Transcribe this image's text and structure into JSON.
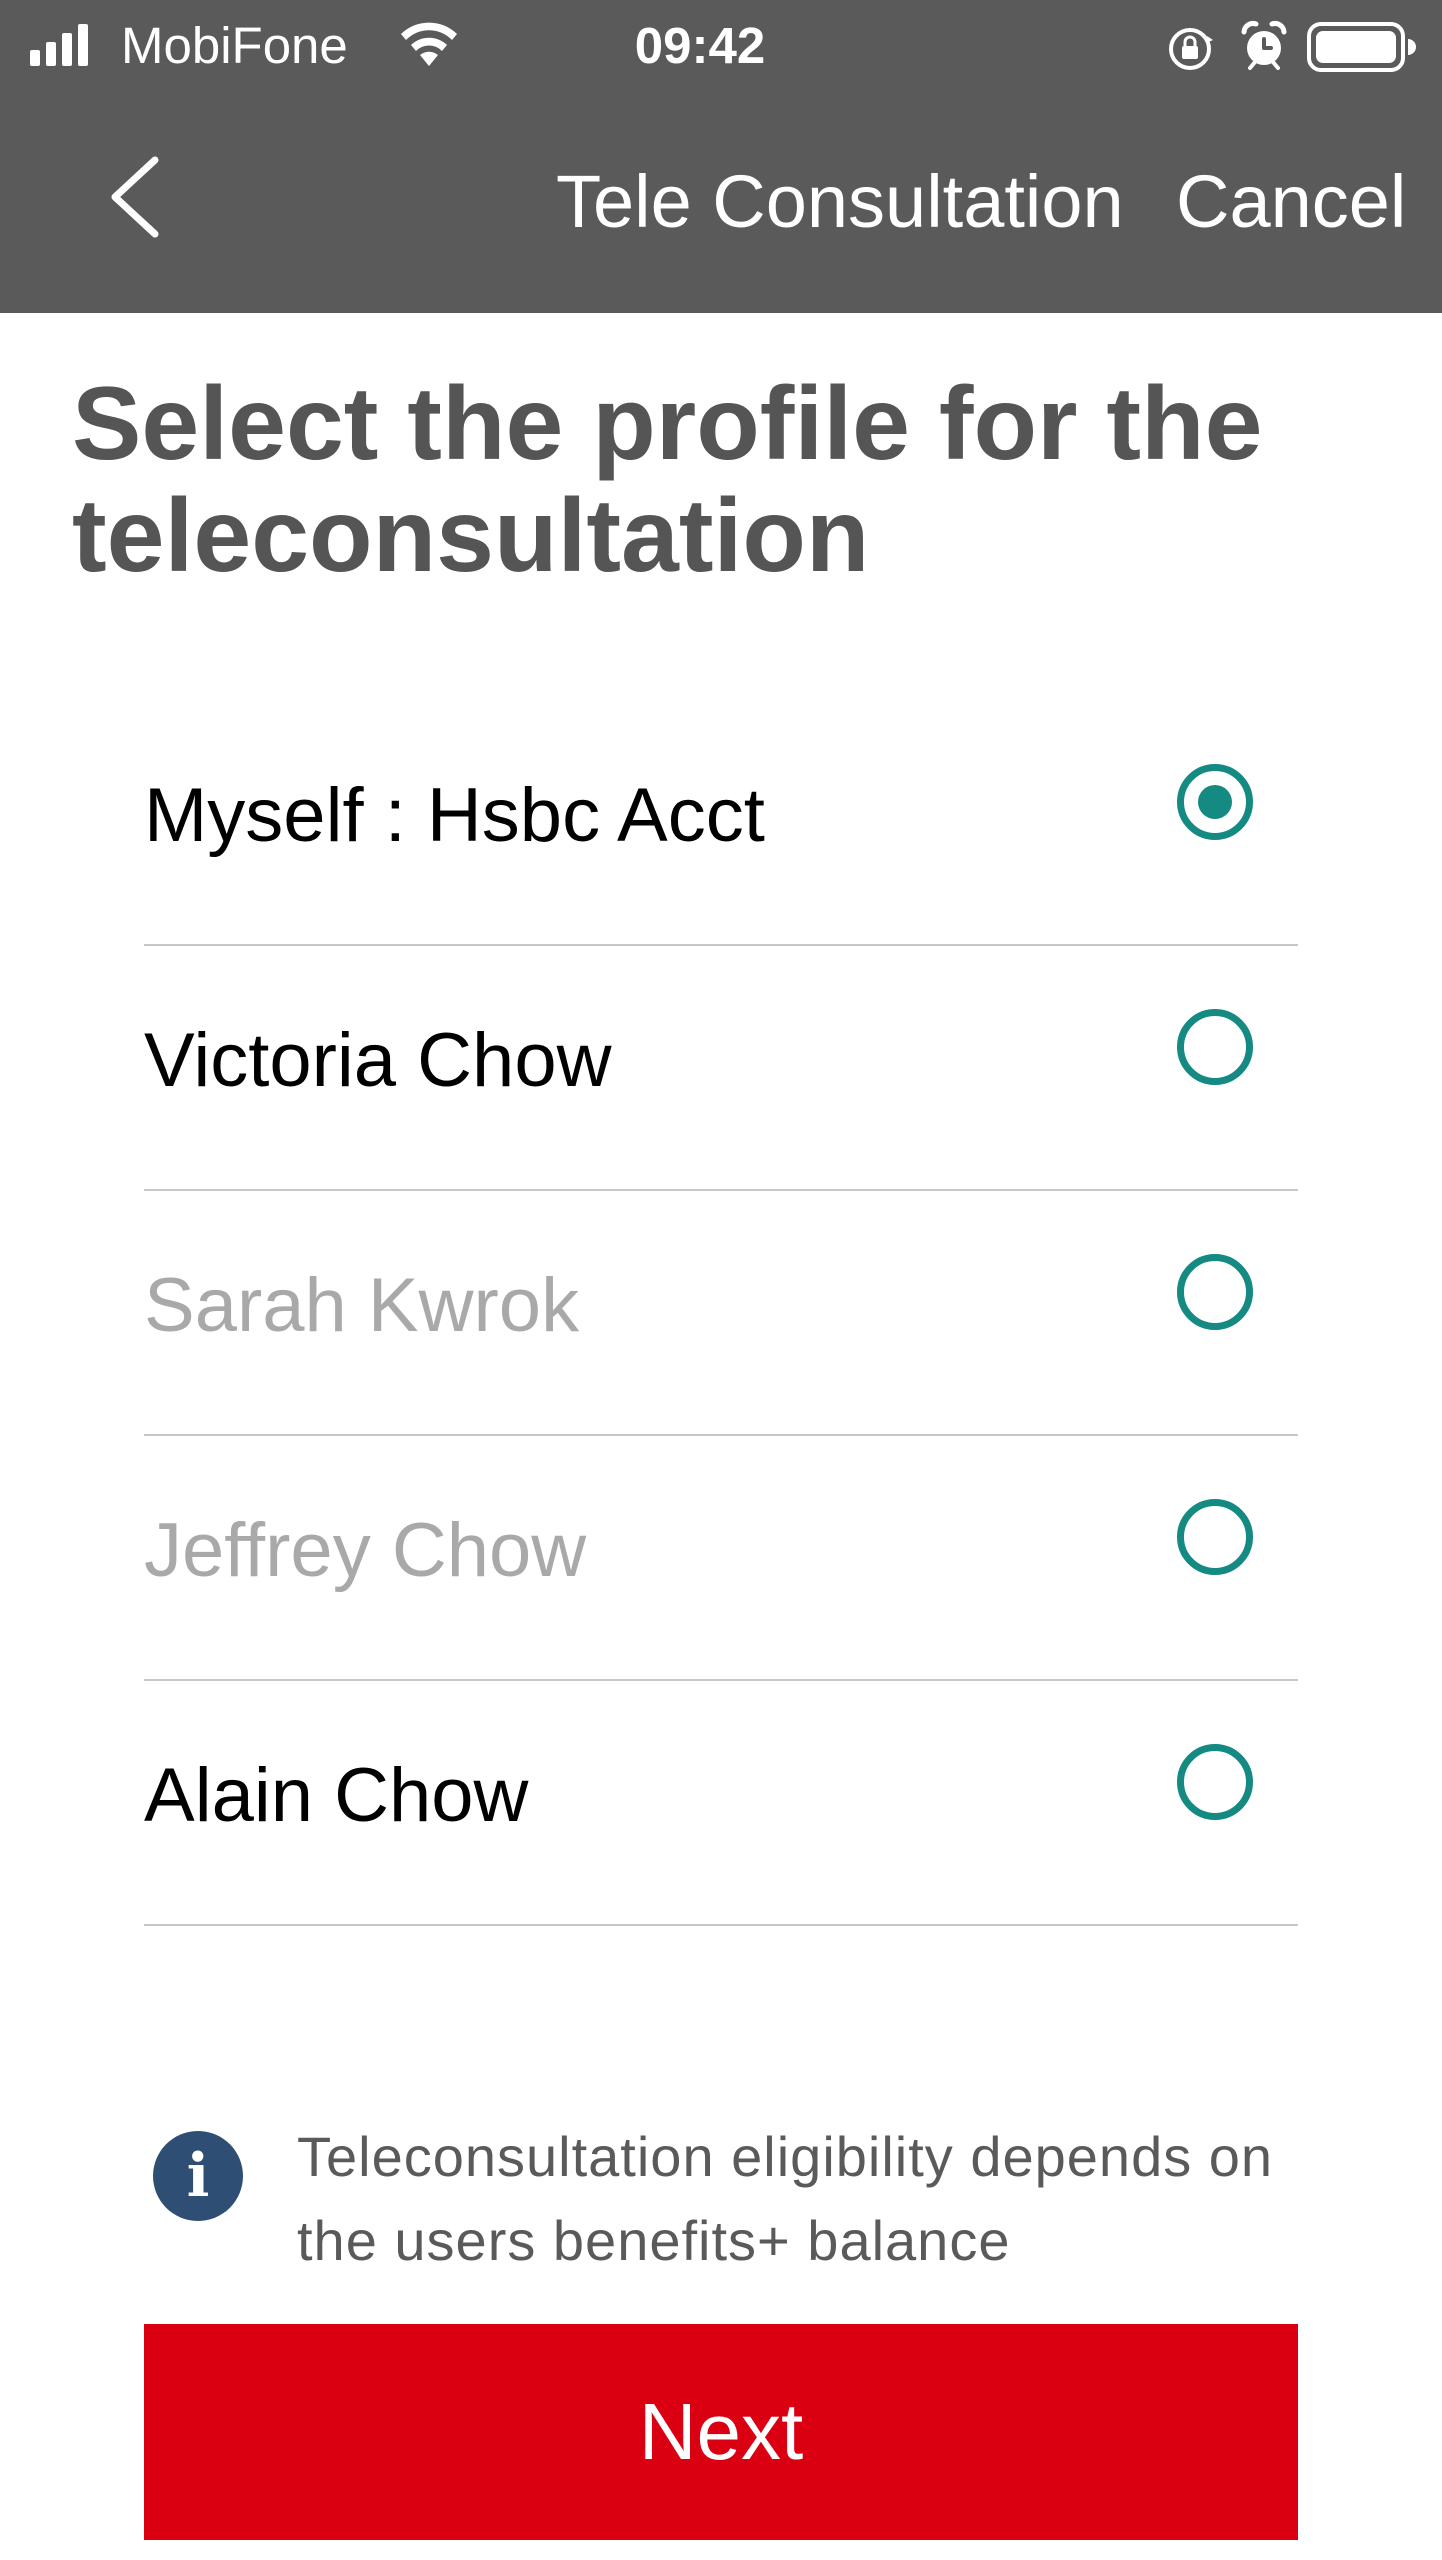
{
  "status_bar": {
    "carrier": "MobiFone",
    "time": "09:42",
    "icons": [
      "signal-icon",
      "wifi-icon",
      "orientation-lock-icon",
      "alarm-icon",
      "battery-icon"
    ]
  },
  "nav": {
    "back_icon": "chevron-left-icon",
    "title": "Tele Consultation",
    "cancel_label": "Cancel"
  },
  "page": {
    "title": "Select the profile for the teleconsultation"
  },
  "profiles": [
    {
      "name": "Myself : Hsbc Acct",
      "selected": true,
      "enabled": true
    },
    {
      "name": "Victoria Chow",
      "selected": false,
      "enabled": true
    },
    {
      "name": "Sarah Kwrok",
      "selected": false,
      "enabled": false
    },
    {
      "name": "Jeffrey Chow",
      "selected": false,
      "enabled": false
    },
    {
      "name": "Alain Chow",
      "selected": false,
      "enabled": true
    }
  ],
  "info": {
    "icon": "info-icon",
    "text": "Teleconsultation eligibility depends on the users benefits+ balance"
  },
  "next_label": "Next",
  "colors": {
    "header_bg": "#5a5a5a",
    "accent_teal": "#148a82",
    "primary_red": "#db0011",
    "info_blue": "#2f4e73",
    "disabled_text": "#a9a9a9"
  }
}
